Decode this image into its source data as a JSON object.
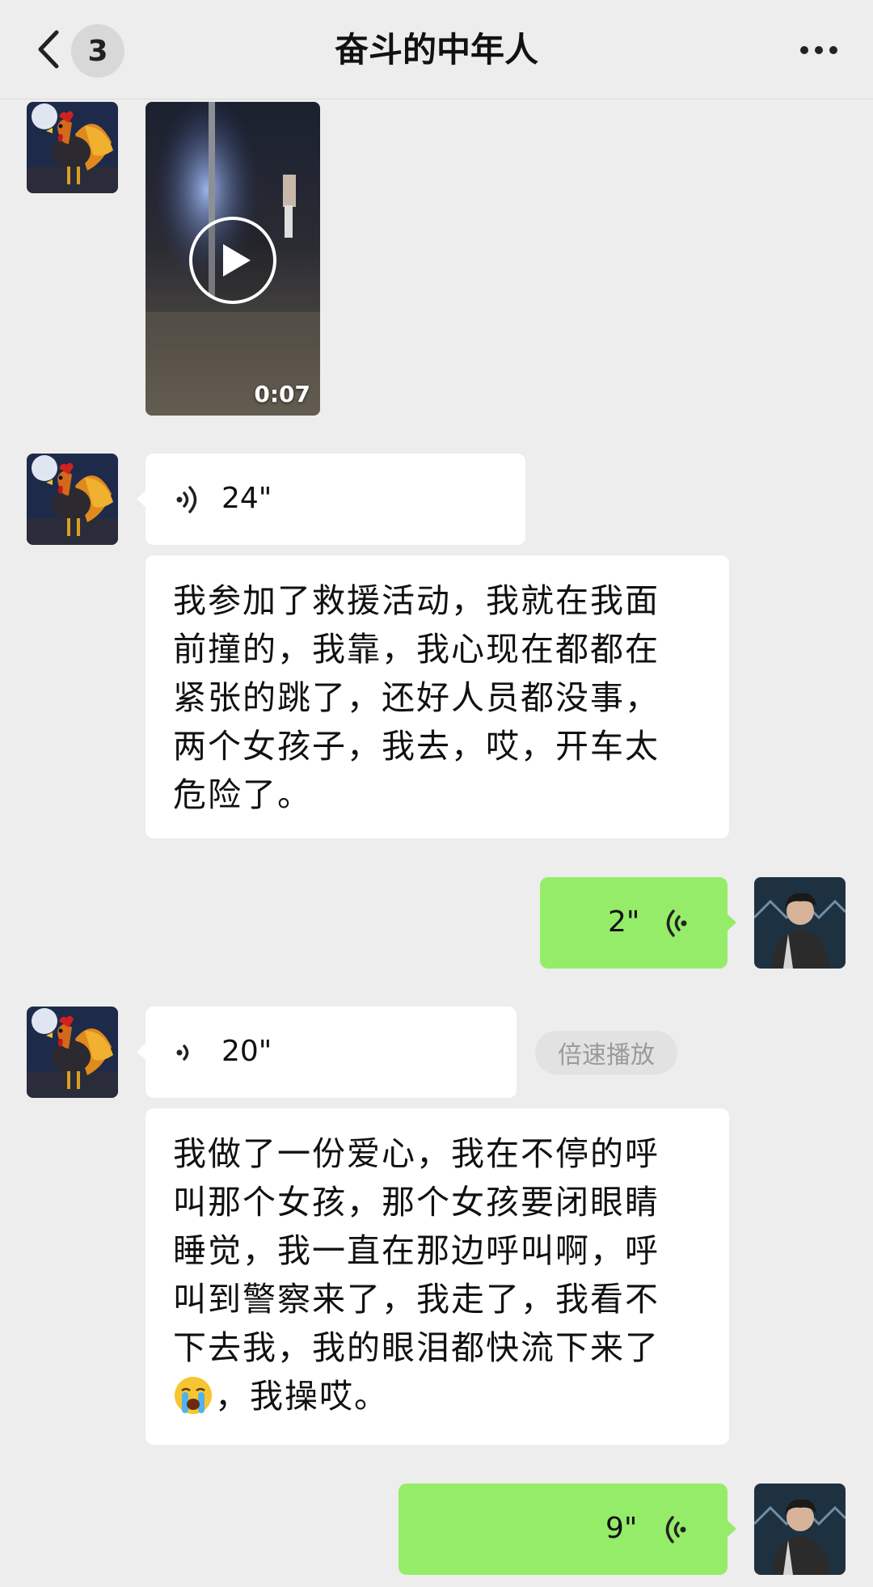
{
  "header": {
    "unread_count": "3",
    "title": "奋斗的中年人"
  },
  "messages": {
    "video": {
      "duration": "0:07"
    },
    "voice1": {
      "duration": "24\""
    },
    "text1": {
      "content": "我参加了救援活动，我就在我面\n前撞的，我靠，我心现在都都在\n紧张的跳了，还好人员都没事，\n两个女孩子，我去，哎，开车太\n危险了。"
    },
    "voice2": {
      "duration": "2\""
    },
    "voice3": {
      "duration": "20\"",
      "speed_label": "倍速播放"
    },
    "text2": {
      "content": "我做了一份爱心，我在不停的呼\n叫那个女孩，那个女孩要闭眼睛\n睡觉，我一直在那边呼叫啊，呼\n叫到警察来了，我走了，我看不\n下去我，我的眼泪都快流下来了",
      "emoji": "crying-face",
      "tail": "，我操哎。"
    },
    "voice4": {
      "duration": "9\""
    }
  },
  "colors": {
    "background": "#ededed",
    "bubble_incoming": "#ffffff",
    "bubble_outgoing": "#95ec69"
  }
}
